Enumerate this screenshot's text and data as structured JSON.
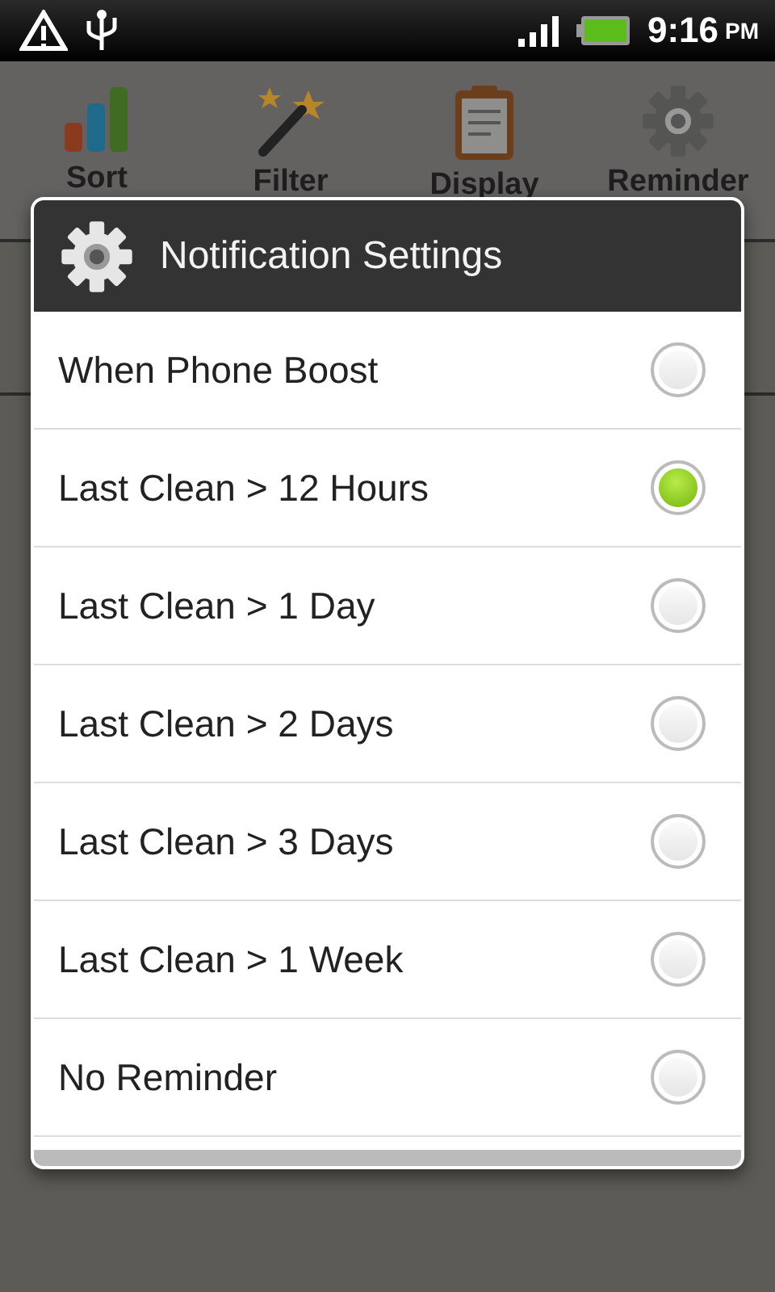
{
  "status_bar": {
    "time": "9:16",
    "meridiem": "PM"
  },
  "toolbar": [
    {
      "label": "Sort",
      "kind": "chart"
    },
    {
      "label": "Filter",
      "kind": "wand"
    },
    {
      "label": "Display",
      "kind": "clipboard"
    },
    {
      "label": "Reminder",
      "kind": "gear"
    }
  ],
  "dialog": {
    "title": "Notification Settings",
    "options": [
      {
        "label": "When Phone Boost",
        "selected": false
      },
      {
        "label": "Last Clean > 12 Hours",
        "selected": true
      },
      {
        "label": "Last Clean > 1 Day",
        "selected": false
      },
      {
        "label": "Last Clean > 2 Days",
        "selected": false
      },
      {
        "label": "Last Clean > 3 Days",
        "selected": false
      },
      {
        "label": "Last Clean > 1 Week",
        "selected": false
      },
      {
        "label": "No Reminder",
        "selected": false
      }
    ]
  }
}
